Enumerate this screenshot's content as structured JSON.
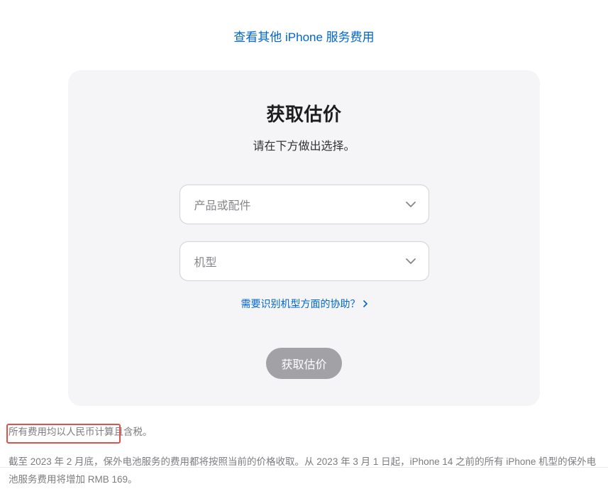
{
  "topLink": "查看其他 iPhone 服务费用",
  "card": {
    "title": "获取估价",
    "subtitle": "请在下方做出选择。",
    "select1": "产品或配件",
    "select2": "机型",
    "helpLink": "需要识别机型方面的协助？",
    "button": "获取估价"
  },
  "footnotes": {
    "note1": "所有费用均以人民币计算且含税。",
    "note2": "截至 2023 年 2 月底，保外电池服务的费用都将按照当前的价格收取。从 2023 年 3 月 1 日起，iPhone 14 之前的所有 iPhone 机型的保外电池服务费用将增加 RMB 169。"
  }
}
